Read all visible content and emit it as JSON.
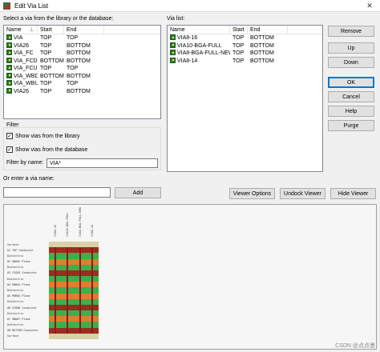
{
  "window": {
    "title": "Edit Via List",
    "close_glyph": "✕"
  },
  "library": {
    "label": "Select a via from the library or the database:",
    "columns": [
      "Name",
      "Start",
      "End"
    ],
    "rows": [
      {
        "name": "VIA",
        "start": "TOP",
        "end": "TOP"
      },
      {
        "name": "VIA26",
        "start": "TOP",
        "end": "BOTTOM"
      },
      {
        "name": "VIA_FC",
        "start": "TOP",
        "end": "BOTTOM"
      },
      {
        "name": "VIA_FCD",
        "start": "BOTTOM",
        "end": "BOTTOM"
      },
      {
        "name": "VIA_FCU",
        "start": "TOP",
        "end": "TOP"
      },
      {
        "name": "VIA_WBD",
        "start": "BOTTOM",
        "end": "BOTTOM"
      },
      {
        "name": "VIA_WBU",
        "start": "TOP",
        "end": "TOP"
      },
      {
        "name": "VIA26",
        "start": "TOP",
        "end": "BOTTOM"
      }
    ],
    "sort_glyph": "⊥"
  },
  "vialist": {
    "label": "Via list:",
    "columns": [
      "Name",
      "Start",
      "End"
    ],
    "rows": [
      {
        "name": "VIA8-16",
        "start": "TOP",
        "end": "BOTTOM"
      },
      {
        "name": "VIA10-BGA-FULL",
        "start": "TOP",
        "end": "BOTTOM"
      },
      {
        "name": "VIA8-BGA-FULL-NEW",
        "start": "TOP",
        "end": "BOTTOM"
      },
      {
        "name": "VIA8-14",
        "start": "TOP",
        "end": "BOTTOM"
      }
    ]
  },
  "buttons": {
    "remove": "Remove",
    "up": "Up",
    "down": "Down",
    "ok": "OK",
    "cancel": "Cancel",
    "help": "Help",
    "purge": "Purge",
    "add": "Add",
    "viewer_options": "Viewer Options",
    "undock_viewer": "Undock Viewer",
    "hide_viewer": "Hide Viewer"
  },
  "filter": {
    "title": "Filter",
    "show_library": "Show vias from the library",
    "show_database": "Show vias from the database",
    "by_name_label": "Filter by name:",
    "by_name_value": "VIA*",
    "check_glyph": "✓",
    "show_library_checked": true,
    "show_database_checked": true
  },
  "enter_via": {
    "label": "Or enter a via name:",
    "value": ""
  },
  "preview": {
    "columns": [
      "VIA8-16",
      "VIA10-BGA-FULL",
      "VIA8-BGA-FULL-NEW",
      "VIA8-14"
    ],
    "layers": [
      "Surface",
      "01  TOP Conductor",
      "Dielectric",
      "02  GND02 Plane",
      "Dielectric",
      "03  SIG03 Conductor",
      "Dielectric",
      "04  PWR04 Plane",
      "Dielectric",
      "05  PWR05 Plane",
      "Dielectric",
      "06  SIG06 Conductor",
      "Dielectric",
      "07  GND07 Plane",
      "Dielectric",
      "08  BOTTOM Conductor",
      "Surface"
    ],
    "colors": {
      "pad": "#9b2d1f",
      "dielectric": "#3cb04a",
      "plane": "#d9822b",
      "barrel": "#8a1a1a",
      "surface": "#d8d2a6"
    }
  },
  "watermark": "CSDN @点点墨"
}
